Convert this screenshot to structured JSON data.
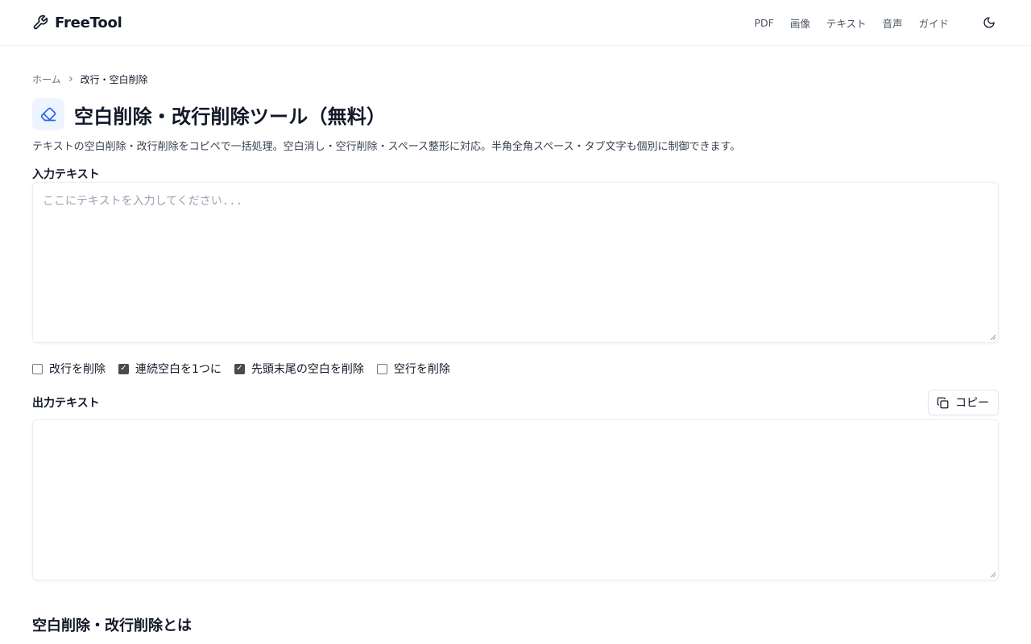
{
  "header": {
    "brand": "FreeTool",
    "nav": [
      "PDF",
      "画像",
      "テキスト",
      "音声",
      "ガイド"
    ]
  },
  "breadcrumb": {
    "home": "ホーム",
    "current": "改行・空白削除"
  },
  "page": {
    "title": "空白削除・改行削除ツール（無料）",
    "description": "テキストの空白削除・改行削除をコピペで一括処理。空白消し・空行削除・スペース整形に対応。半角全角スペース・タブ文字も個別に制御できます。"
  },
  "input": {
    "label": "入力テキスト",
    "placeholder": "ここにテキストを入力してください...",
    "value": ""
  },
  "options": [
    {
      "label": "改行を削除",
      "checked": false
    },
    {
      "label": "連続空白を1つに",
      "checked": true
    },
    {
      "label": "先頭末尾の空白を削除",
      "checked": true
    },
    {
      "label": "空行を削除",
      "checked": false
    }
  ],
  "output": {
    "label": "出力テキスト",
    "copy_label": "コピー",
    "value": ""
  },
  "section": {
    "title": "空白削除・改行削除とは"
  },
  "colors": {
    "accent": "#2563eb",
    "icon_bg": "#eef4ff",
    "checked": "#4b4b4b"
  },
  "icons": {
    "brand": "wrench-icon",
    "theme": "moon-icon",
    "title": "eraser-icon",
    "copy": "copy-icon",
    "breadcrumb_separator": "chevron-right-icon"
  }
}
